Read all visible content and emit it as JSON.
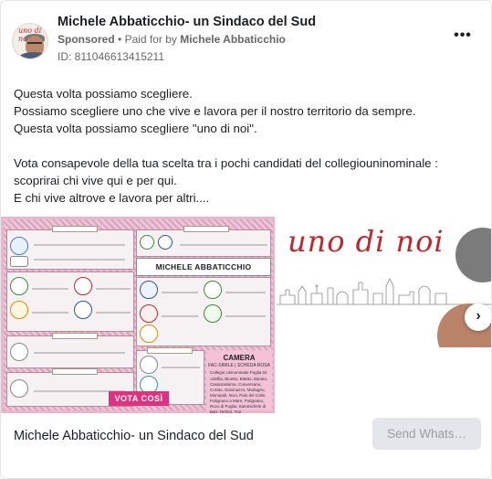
{
  "header": {
    "page_name": "Michele Abbaticchio- un Sindaco del Sud",
    "sponsored": "Sponsored",
    "separator": "•",
    "paid_for_by_prefix": "Paid for by",
    "paid_for_by_name": "Michele Abbaticchio",
    "ad_id": "ID: 811046613415211",
    "more_icon": "more-horizontal-icon",
    "more_label": "•••"
  },
  "avatar": {
    "script_text": "uno di noi"
  },
  "post": {
    "text_block_1": "Questa volta possiamo scegliere.\nPossiamo scegliere uno che vive e lavora per il nostro territorio da sempre.\nQuesta volta possiamo scegliere \"uno di noi\".",
    "text_block_2": "Vota consapevole della tua scelta tra i pochi candidati del collegiouninominale :\nscoprirai chi vive qui e per qui.\nE chi vive altrove e lavora per altri...."
  },
  "carousel": {
    "slide1": {
      "candidate_name": "MICHELE ABBATICCHIO",
      "camera_title": "CAMERA",
      "camera_sub": "FAC-SIMILE | SCHEDA ROSA",
      "camera_collegio": "Collegio Uninominale Puglia 04",
      "camera_towns": "Adelfia, Binetto, Bitetto, Bitonto, Casamassima, Conversano, Corato, Giovinazzo, Modugno, Monopoli, Noci, Palo del Colle, Polignano a Mare, Putignano, Ruvo di Puglia, Sammichele di Bari, Terlizzi, Turi",
      "vota_label": "VOTA COSÌ"
    },
    "slide2": {
      "script_title": "uno di noi"
    },
    "next_icon": "chevron-right-icon",
    "next_glyph": "›"
  },
  "footer": {
    "title": "Michele Abbaticchio- un Sindaco del Sud",
    "cta_label": "Send Whats…"
  },
  "colors": {
    "accent_red": "#c0262b",
    "ballot_pink": "#e8b7cc",
    "vota_magenta": "#e0317e",
    "cta_bg": "#e4e6eb"
  }
}
